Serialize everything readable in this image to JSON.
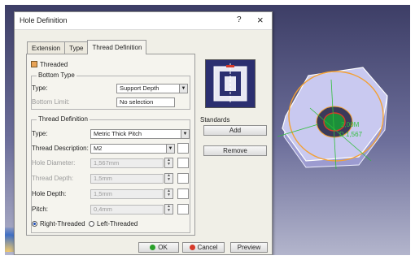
{
  "dialog": {
    "title": "Hole Definition",
    "help_glyph": "?",
    "close_glyph": "×"
  },
  "tabs": [
    {
      "label": "Extension"
    },
    {
      "label": "Type"
    },
    {
      "label": "Thread Definition",
      "active": true
    }
  ],
  "threaded": {
    "label": "Threaded",
    "checked": true
  },
  "bottom_type": {
    "group_label": "Bottom Type",
    "type_label": "Type:",
    "type_value": "Support Depth",
    "limit_label": "Bottom Limit:",
    "limit_value": "No selection"
  },
  "thread_definition": {
    "group_label": "Thread Definition",
    "type_label": "Type:",
    "type_value": "Metric Thick Pitch",
    "description_label": "Thread Description:",
    "description_value": "M2",
    "hole_diameter_label": "Hole Diameter:",
    "hole_diameter_value": "1,567mm",
    "thread_depth_label": "Thread Depth:",
    "thread_depth_value": "1,5mm",
    "hole_depth_label": "Hole Depth:",
    "hole_depth_value": "1,5mm",
    "pitch_label": "Pitch:",
    "pitch_value": "0,4mm",
    "right_threaded_label": "Right-Threaded",
    "left_threaded_label": "Left-Threaded",
    "direction_selected": "Right-Threaded"
  },
  "standards": {
    "label": "Standards",
    "add_label": "Add",
    "remove_label": "Remove"
  },
  "footer": {
    "ok_label": "OK",
    "cancel_label": "Cancel",
    "preview_label": "Preview"
  },
  "viewport": {
    "annotation_lines": [
      "2,00M",
      "D 1,567"
    ],
    "colors": {
      "background_top": "#3d3e66",
      "part": "#c9c9f0",
      "selection": "#f3a033",
      "dimension": "#2fbf3a"
    }
  }
}
